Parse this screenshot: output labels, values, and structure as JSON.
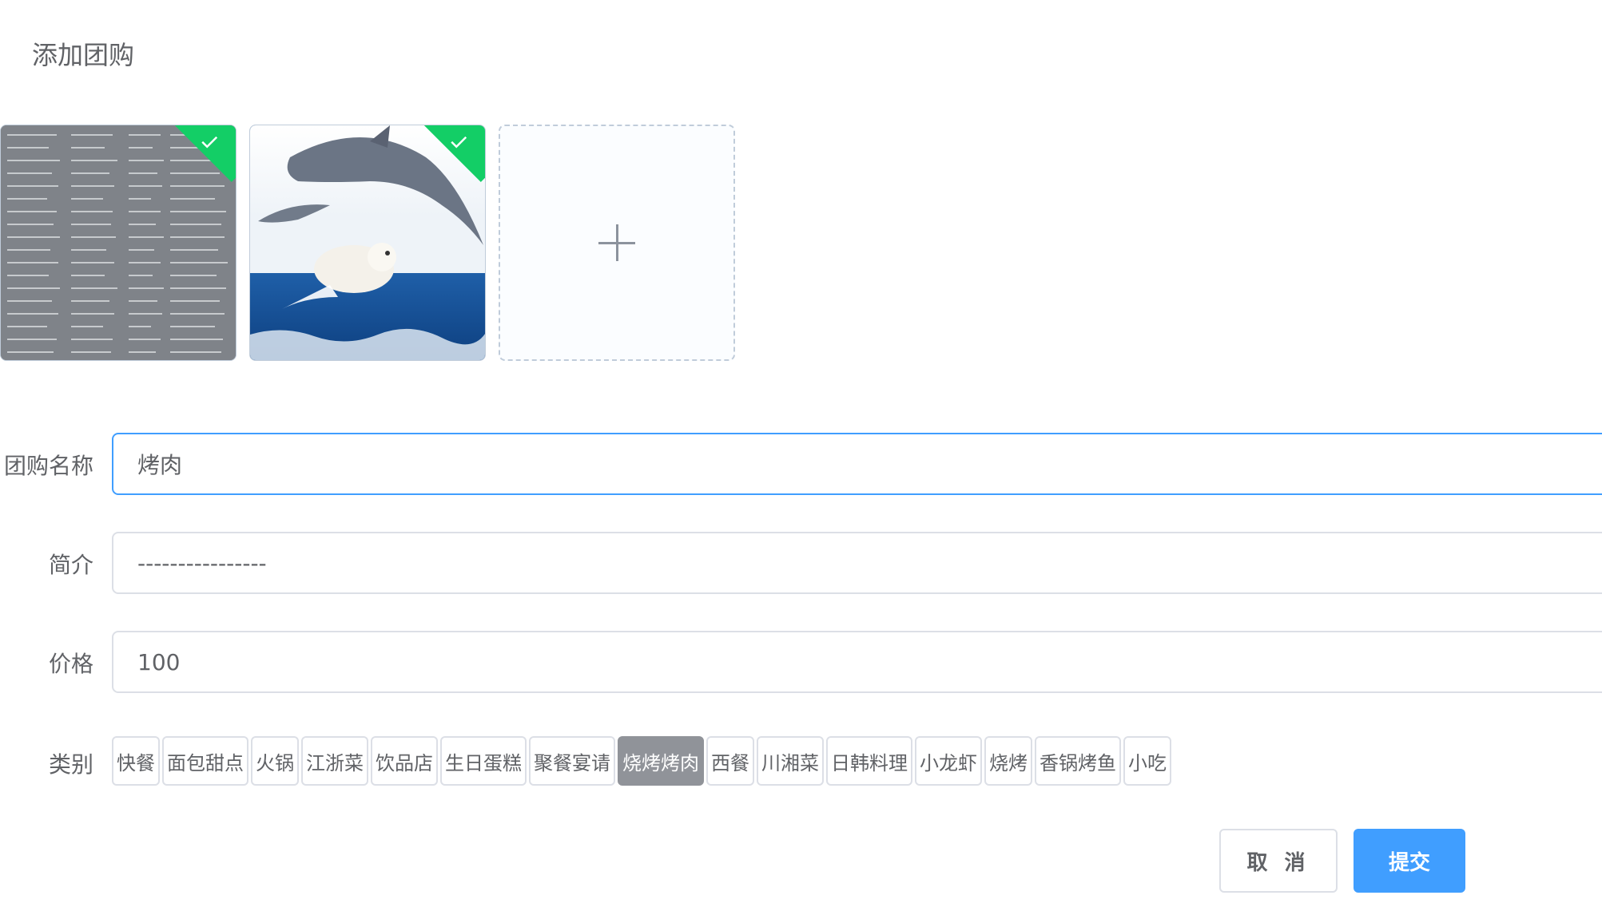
{
  "page": {
    "title": "添加团购"
  },
  "upload": {
    "images": [
      {
        "icon": "document-thumbnail-image",
        "status": "success"
      },
      {
        "icon": "dolphin-and-dog-photo",
        "status": "success"
      }
    ],
    "add_icon": "plus-icon"
  },
  "form": {
    "name": {
      "label": "团购名称",
      "value": "烤肉"
    },
    "intro": {
      "label": "简介",
      "value": "----------------"
    },
    "price": {
      "label": "价格",
      "value": "100"
    },
    "category": {
      "label": "类别",
      "options": [
        "快餐",
        "面包甜点",
        "火锅",
        "江浙菜",
        "饮品店",
        "生日蛋糕",
        "聚餐宴请",
        "烧烤烤肉",
        "西餐",
        "川湘菜",
        "日韩料理",
        "小龙虾",
        "烧烤",
        "香锅烤鱼",
        "小吃"
      ],
      "selected_index": 7
    }
  },
  "buttons": {
    "cancel": "取 消",
    "submit": "提交"
  },
  "colors": {
    "primary": "#409eff",
    "success": "#13ce66",
    "selected_tag": "#909399",
    "border": "#dcdfe6"
  }
}
